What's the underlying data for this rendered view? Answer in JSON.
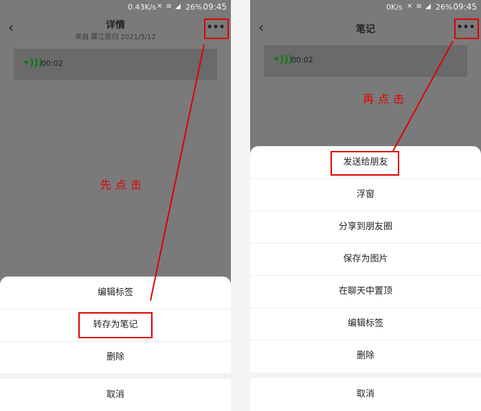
{
  "left_screen": {
    "status": {
      "speed": "0.43K/s",
      "icons": "✕ ≋ ◢",
      "battery": "26%",
      "time": "09:45"
    },
    "header": {
      "title": "详情",
      "subtitle": "来自 雾江思归 2021/5/12"
    },
    "voice": {
      "duration": "00:02"
    },
    "sheet": {
      "items": [
        "编辑标签",
        "转存为笔记",
        "删除"
      ],
      "cancel": "取消"
    },
    "annotation": "先点击"
  },
  "right_screen": {
    "status": {
      "speed": "0K/s",
      "icons": "✕ ≋ ◢",
      "battery": "26%",
      "time": "09:45"
    },
    "header": {
      "title": "笔记"
    },
    "voice": {
      "duration": "00:02"
    },
    "sheet": {
      "items": [
        "发送给朋友",
        "浮窗",
        "分享到朋友圈",
        "保存为图片",
        "在聊天中置顶",
        "编辑标签",
        "删除"
      ],
      "cancel": "取消"
    },
    "annotation": "再点击"
  },
  "icons": {
    "back": "chevron-left-icon",
    "more": "ellipsis-icon",
    "voice": "voice-wave-icon"
  },
  "colors": {
    "overlay": "#7a7a7a",
    "highlight": "#e00000",
    "voice_icon": "#0a7a0a"
  }
}
